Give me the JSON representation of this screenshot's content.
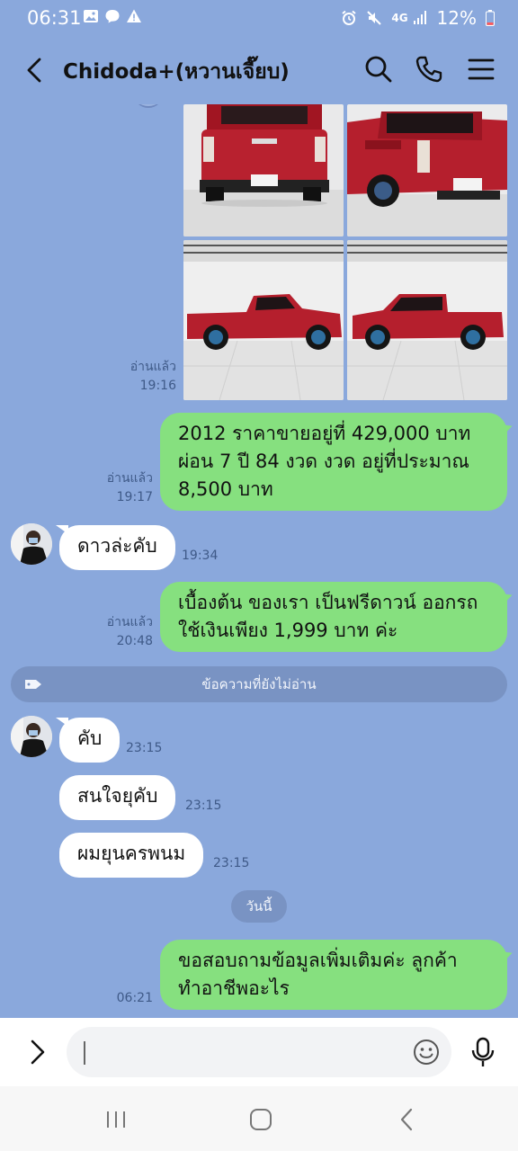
{
  "status_bar": {
    "time": "06:31",
    "network": "4G",
    "battery": "12%"
  },
  "header": {
    "title": "Chidoda+(หวานเจี๊ยบ)"
  },
  "messages": {
    "photos": {
      "read_label": "อ่านแล้ว",
      "time": "19:16"
    },
    "price": {
      "read_label": "อ่านแล้ว",
      "time": "19:17",
      "line1": "2012 ราคาขายอยู่ที่ 429,000 บาท",
      "line2": "ผ่อน 7 ปี 84 งวด งวด อยู่ที่ประมาณ",
      "line3": "8,500 บาท"
    },
    "down_payment_question": {
      "text": "ดาวล่ะคับ",
      "time": "19:34"
    },
    "down_payment_answer": {
      "read_label": "อ่านแล้ว",
      "time": "20:48",
      "line1": "เบื้องต้น ของเรา เป็นฟรีดาวน์ ออกรถ",
      "line2": "ใช้เงินเพียง 1,999 บาท ค่ะ"
    },
    "unread_divider": "ข้อความที่ยังไม่อ่าน",
    "reply1": {
      "text": "คับ",
      "time": "23:15"
    },
    "reply2": {
      "text": "สนใจยุคับ",
      "time": "23:15"
    },
    "reply3": {
      "text": "ผมยุนครพนม",
      "time": "23:15"
    },
    "date_divider": "วันนี้",
    "last": {
      "time": "06:21",
      "line1": "ขอสอบถามข้อมูลเพิ่มเติมค่ะ ลูกค้า",
      "line2": "ทำอาชีพอะไร"
    }
  },
  "input": {
    "value": ""
  },
  "icons": {
    "back": "chevron-left-icon",
    "search": "search-icon",
    "call": "phone-icon",
    "menu": "menu-icon",
    "expand": "chevron-right-icon",
    "emoji": "emoji-icon",
    "mic": "microphone-icon"
  },
  "colors": {
    "chat_background": "#8aa8dc",
    "outgoing_bubble": "#86e07f",
    "incoming_bubble": "#ffffff"
  }
}
